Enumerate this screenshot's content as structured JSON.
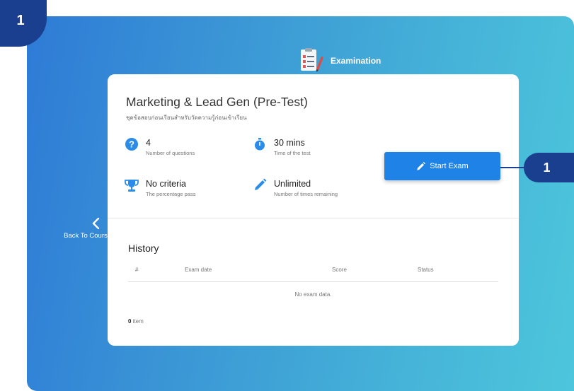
{
  "step_badges": {
    "top_left": "1",
    "callout": "1"
  },
  "header": {
    "title": "Examination",
    "icon": "exam-document-icon"
  },
  "back": {
    "label": "Back To Course Page",
    "icon": "chevron-left-icon"
  },
  "exam": {
    "title": "Marketing & Lead Gen (Pre-Test)",
    "subtitle": "ชุดข้อสอบก่อนเรียนสำหรับวัดความรู้ก่อนเข้าเรียน",
    "stats": {
      "questions": {
        "value": "4",
        "label": "Number of questions",
        "icon": "question-circle-icon"
      },
      "time": {
        "value": "30 mins",
        "label": "Time of the test",
        "icon": "stopwatch-icon"
      },
      "criteria": {
        "value": "No criteria",
        "label": "The percentage pass",
        "icon": "trophy-icon"
      },
      "attempts": {
        "value": "Unlimited",
        "label": "Number of times remaining",
        "icon": "pencil-icon"
      }
    },
    "start_button": {
      "label": "Start Exam",
      "icon": "pencil-icon"
    }
  },
  "history": {
    "title": "History",
    "columns": [
      "#",
      "Exam date",
      "Score",
      "Status"
    ],
    "empty_text": "No exam data.",
    "count_number": "0",
    "count_suffix": " item"
  },
  "colors": {
    "badge": "#1b3f8f",
    "button": "#1e82e6",
    "gradient_start": "#2e7bd6",
    "gradient_end": "#4dc6dc"
  }
}
